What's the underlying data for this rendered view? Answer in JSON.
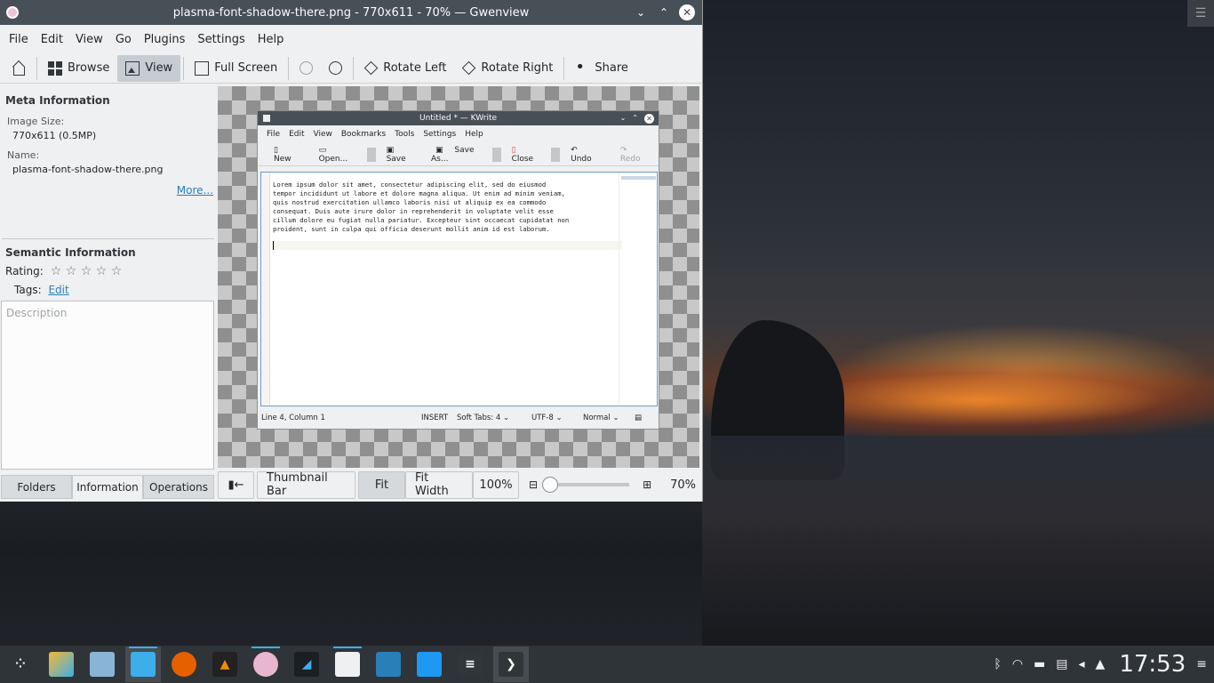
{
  "window": {
    "title": "plasma-font-shadow-there.png - 770x611 - 70% — Gwenview",
    "minimize": "⌄",
    "maximize": "⌃",
    "close": "✕"
  },
  "menubar": [
    "File",
    "Edit",
    "View",
    "Go",
    "Plugins",
    "Settings",
    "Help"
  ],
  "toolbar": {
    "browse": "Browse",
    "view": "View",
    "fullscreen": "Full Screen",
    "rotate_left": "Rotate Left",
    "rotate_right": "Rotate Right",
    "share": "Share"
  },
  "sidebar": {
    "meta_title": "Meta Information",
    "size_label": "Image Size:",
    "size_value": "770x611 (0.5MP)",
    "name_label": "Name:",
    "name_value": "plasma-font-shadow-there.png",
    "more_link": "More...",
    "semantic_title": "Semantic Information",
    "rating_label": "Rating:",
    "rating_stars": "☆ ☆ ☆ ☆ ☆",
    "rating_value": 0,
    "tags_label": "Tags:",
    "tags_edit": "Edit",
    "description_placeholder": "Description",
    "tabs": [
      "Folders",
      "Information",
      "Operations"
    ]
  },
  "viewbar": {
    "toggle_sidebar": "▮←",
    "thumbnail_bar": "Thumbnail Bar",
    "fit": "Fit",
    "fit_width": "Fit Width",
    "hundred": "100%",
    "zoom": "70%"
  },
  "kwrite": {
    "title": "Untitled * — KWrite",
    "menu": [
      "File",
      "Edit",
      "View",
      "Bookmarks",
      "Tools",
      "Settings",
      "Help"
    ],
    "tools": {
      "new": "New",
      "open": "Open...",
      "save": "Save",
      "save_as": "Save As...",
      "close": "Close",
      "undo": "Undo",
      "redo": "Redo"
    },
    "text": "Lorem ipsum dolor sit amet, consectetur adipiscing elit, sed do eiusmod\ntempor incididunt ut labore et dolore magna aliqua. Ut enim ad minim veniam,\nquis nostrud exercitation ullamco laboris nisi ut aliquip ex ea commodo\nconsequat. Duis aute irure dolor in reprehenderit in voluptate velit esse\ncillum dolore eu fugiat nulla pariatur. Excepteur sint occaecat cupidatat non\nproident, sunt in culpa qui officia deserunt mollit anim id est laborum.",
    "status": {
      "position": "Line 4, Column 1",
      "mode": "INSERT",
      "tabs": "Soft Tabs: 4",
      "encoding": "UTF-8",
      "syntax": "Normal"
    }
  },
  "taskbar": {
    "clock": "17:53"
  }
}
